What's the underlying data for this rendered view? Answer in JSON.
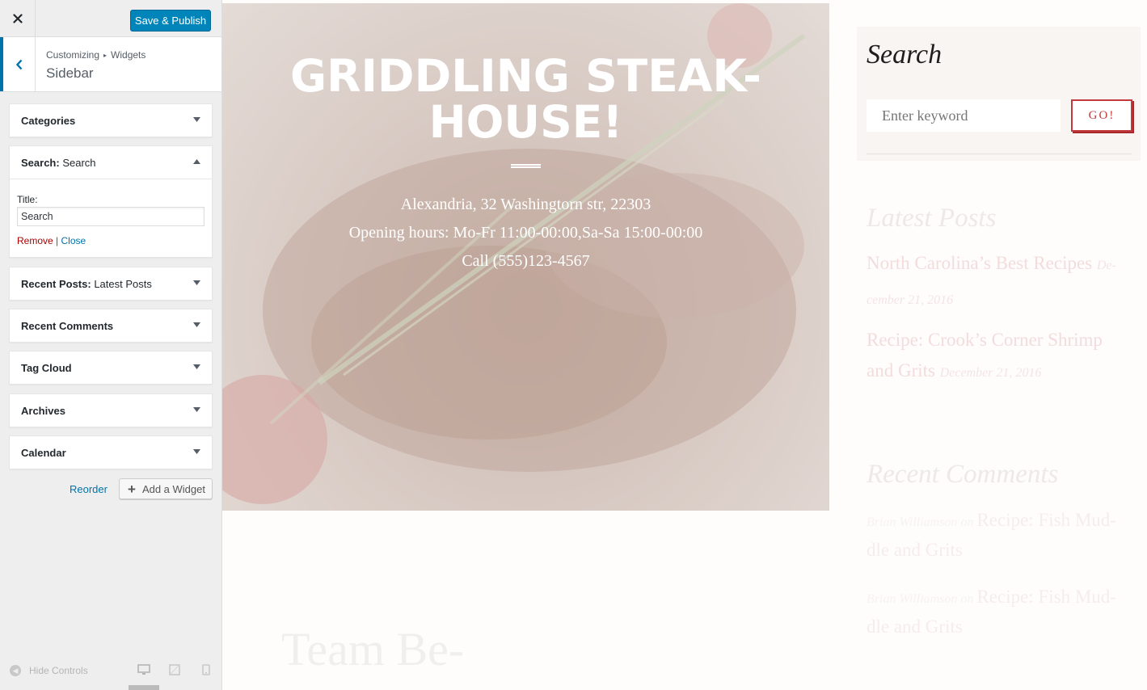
{
  "customizer": {
    "save_label": "Save & Publish",
    "breadcrumb_root": "Customizing",
    "breadcrumb_sep": "▸",
    "breadcrumb_current": "Widgets",
    "section_title": "Sidebar",
    "widgets": [
      {
        "name": "Categories",
        "subtitle": ""
      },
      {
        "name": "Search",
        "subtitle": "Search",
        "expanded": true
      },
      {
        "name": "Recent Posts",
        "subtitle": "Latest Posts"
      },
      {
        "name": "Recent Comments",
        "subtitle": ""
      },
      {
        "name": "Tag Cloud",
        "subtitle": ""
      },
      {
        "name": "Archives",
        "subtitle": ""
      },
      {
        "name": "Calendar",
        "subtitle": ""
      }
    ],
    "search_form": {
      "title_label": "Title:",
      "title_value": "Search",
      "remove_label": "Remove",
      "link_sep": "|",
      "close_label": "Close"
    },
    "reorder_label": "Reorder",
    "add_widget_label": "Add a Widget",
    "hide_controls_label": "Hide Controls"
  },
  "preview": {
    "hero": {
      "title": "GRIDDLING STEAK-HOUSE!",
      "address": "Alexandria, 32 Washingtorn str, 22303",
      "hours": "Opening hours: Mo-Fr 11:00-00:00,Sa-Sa 15:00-00:00",
      "phone": "Call (555)123-4567"
    },
    "search_widget": {
      "title": "Search",
      "placeholder": "Enter keyword",
      "button": "GO!"
    },
    "latest_posts": {
      "title": "Latest Posts",
      "posts": [
        {
          "line1": "North Carolina’s Best Recipes",
          "date_part1": "De-",
          "date_part2": "cember 21, 2016"
        },
        {
          "line1": "Recipe: Crook’s Corner Shrimp",
          "line2": "and Grits",
          "date": "December 21, 2016"
        }
      ]
    },
    "recent_comments": {
      "title": "Recent Comments",
      "comments": [
        {
          "author": "Brian Williamson",
          "on": "on",
          "post_line1": "Recipe: Fish Mud-",
          "post_line2": "dle and Grits"
        },
        {
          "author": "Brian Williamson",
          "on": "on",
          "post_line1": "Recipe: Fish Mud-",
          "post_line2": "dle and Grits"
        }
      ]
    },
    "team_heading": "Team Be-"
  },
  "colors": {
    "accent": "#0073aa",
    "button_primary": "#0085ba",
    "remove_link": "#aa0000",
    "go_button": "#c23a3e"
  }
}
